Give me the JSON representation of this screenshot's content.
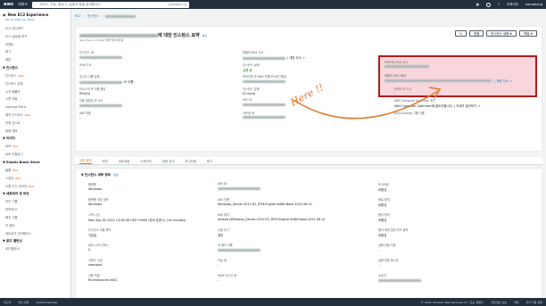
{
  "topnav": {
    "logo": "aws",
    "services": "서비스",
    "search_placeholder": "서비스, 기능, 블로그, 설명서 등을 검색합니다",
    "search_hint": "[Option+S]",
    "region": "오하이오",
    "account": "psmeeong"
  },
  "sidebar": {
    "header": "New EC2 Experience",
    "header_sub": "Tell us what you think",
    "items": [
      {
        "type": "item",
        "label": "EC2 대시보드"
      },
      {
        "type": "item",
        "label": "EC2 글로벌 보기"
      },
      {
        "type": "item",
        "label": "이벤트"
      },
      {
        "type": "item",
        "label": "태그"
      },
      {
        "type": "item",
        "label": "제한"
      },
      {
        "type": "section",
        "label": "▼ 인스턴스"
      },
      {
        "type": "item",
        "label": "인스턴스",
        "badge": "New"
      },
      {
        "type": "item",
        "label": "인스턴스 유형"
      },
      {
        "type": "item",
        "label": "시작 템플릿"
      },
      {
        "type": "item",
        "label": "스팟 요청"
      },
      {
        "type": "item",
        "label": "Savings Plans"
      },
      {
        "type": "item",
        "label": "예약 인스턴스",
        "badge": "New"
      },
      {
        "type": "item",
        "label": "전용 호스트"
      },
      {
        "type": "item",
        "label": "용량 예약"
      },
      {
        "type": "section",
        "label": "▼ 이미지"
      },
      {
        "type": "item",
        "label": "AMI",
        "badge": "New"
      },
      {
        "type": "item",
        "label": "AMI 카탈로그"
      },
      {
        "type": "section",
        "label": "▼ Elastic Block Store"
      },
      {
        "type": "item",
        "label": "볼륨",
        "badge": "New"
      },
      {
        "type": "item",
        "label": "스냅샷",
        "badge": "New"
      },
      {
        "type": "item",
        "label": "수명 주기 관리자",
        "badge": "New"
      },
      {
        "type": "section",
        "label": "▼ 네트워크 및 보안"
      },
      {
        "type": "item",
        "label": "보안 그룹"
      },
      {
        "type": "item",
        "label": "탄력적 IP"
      },
      {
        "type": "item",
        "label": "배치 그룹"
      },
      {
        "type": "item",
        "label": "키 페어"
      },
      {
        "type": "item",
        "label": "네트워크 인터페이스"
      },
      {
        "type": "section",
        "label": "▼ 로드 밸런싱"
      },
      {
        "type": "item",
        "label": "로드밸런서"
      }
    ]
  },
  "breadcrumb": [
    "EC2",
    "인스턴스"
  ],
  "summary": {
    "title_suffix": "에 대한 인스턴스 요약",
    "info": "정보",
    "subtitle": "less than a minute 전에 업데이트됨",
    "buttons": {
      "refresh": "↻",
      "connect": "연결",
      "state": "인스턴스 상태 ▼",
      "actions": "작업 ▼"
    },
    "fields": [
      {
        "label": "인스턴스 ID",
        "value": "",
        "redacted": true
      },
      {
        "label": "퍼블릭 IPv4 주소",
        "value": "| 개방 주소 ↗",
        "redacted": true
      },
      {
        "label": "",
        "value": ""
      },
      {
        "label": "IPv6 주소",
        "value": "–"
      },
      {
        "label": "인스턴스 상태",
        "value": "실행 중",
        "style": "green"
      },
      {
        "label": "",
        "value": ""
      },
      {
        "label": "호스트 이름 유형",
        "value": "IP 이름:",
        "redacted": true
      },
      {
        "label": "프라이빗 IP DNS 이름(IPv4만 해당)",
        "value": "",
        "redacted": true
      },
      {
        "label": "",
        "value": ""
      },
      {
        "label": "리소스의 IP 이름 응답",
        "value": "IPv4(A)"
      },
      {
        "label": "인스턴스 유형",
        "value": "t2.micro"
      },
      {
        "label": "탄력적 IP 주소",
        "value": "–"
      },
      {
        "label": "자동 할당된 IP 주소",
        "value": "",
        "redacted": true
      },
      {
        "label": "VPC ID",
        "value": "",
        "redacted": true
      },
      {
        "label": "AWS Compute Optimizer 찾기",
        "value": "AWS Compute Optimizer에 옵트인합니다. | 자세히 알아보기 ↗"
      },
      {
        "label": "IAM 역할",
        "value": "–"
      },
      {
        "label": "서브넷 ID",
        "value": "",
        "redacted": true
      },
      {
        "label": "Auto Scaling 그룹 이름",
        "value": "–"
      }
    ],
    "highlight": {
      "label1": "프라이빗 IPv4 주소",
      "label2": "퍼블릭 IPv4 DNS",
      "suffix": "| 개방 주소 ↗"
    }
  },
  "annotation": "Here !!",
  "tabs": [
    "세부 정보",
    "보안",
    "네트워킹",
    "스토리지",
    "상태 검사",
    "모니터링",
    "태그"
  ],
  "details": {
    "head": "▼ 인스턴스 세부 정보",
    "info": "정보",
    "fields": [
      {
        "label": "플랫폼",
        "value": "Windows"
      },
      {
        "label": "AMI ID",
        "value": "",
        "redacted": true
      },
      {
        "label": "모니터링",
        "value": "비활성"
      },
      {
        "label": "플랫폼 세부 정보",
        "value": "Windows"
      },
      {
        "label": "AMI 이름",
        "value": "Windows_Server-2012-R2_RTM-English-64Bit-Base-2022.08.10"
      },
      {
        "label": "종료 방지",
        "value": "비활성"
      },
      {
        "label": "시작 시간",
        "value": "Mon Sep 05 2022 13:28:58 GMT+0900 (한국 표준시) (15 minutes)"
      },
      {
        "label": "AMI 위치",
        "value": "amazon/Windows_Server-2012-R2_RTM-English-64Bit-Base-2022.08.10"
      },
      {
        "label": "중지 방지",
        "value": "비활성"
      },
      {
        "label": "인스턴스 자동 복구",
        "value": "기본값"
      },
      {
        "label": "수명 주기",
        "value": "일반"
      },
      {
        "label": "중지-최대 절전 모드 동작",
        "value": "비활성"
      },
      {
        "label": "AMI 시작 인덱스",
        "value": "0"
      },
      {
        "label": "키 페어 이름",
        "value": "",
        "redacted": true
      },
      {
        "label": "상태 전환 이유",
        "value": "–"
      },
      {
        "label": "크레딧 사양",
        "value": "standard"
      },
      {
        "label": "커널 ID",
        "value": "–"
      },
      {
        "label": "상태 전환 메시지",
        "value": "–"
      },
      {
        "label": "사용 작업",
        "value": "RunInstances:0002"
      },
      {
        "label": "RAM 디스크 ID",
        "value": "–"
      },
      {
        "label": "소유자",
        "value": "",
        "redacted": true
      }
    ]
  },
  "footer": {
    "feedback": "피드백",
    "language": "언어 선택",
    "unified": "Unified Settings",
    "copyright": "© 2022, Amazon Web Services, Inc. 또는 계열사.",
    "privacy": "개인정보 보호",
    "terms": "약관",
    "cookie": "쿠키 기본 설정"
  }
}
